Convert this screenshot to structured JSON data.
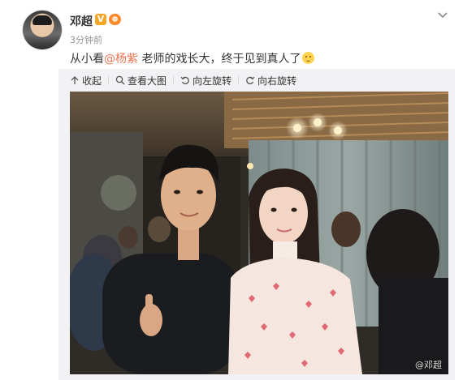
{
  "header": {
    "username": "邓超",
    "verified_badge": "V",
    "timestamp": "3分钟前"
  },
  "post": {
    "text_before": "从小看",
    "mention": "@杨紫",
    "text_after": " 老师的戏长大，终于见到真人了"
  },
  "toolbar": {
    "collapse_label": "收起",
    "view_large_label": "查看大图",
    "rotate_left_label": "向左旋转",
    "rotate_right_label": "向右旋转"
  },
  "photo": {
    "watermark": "@邓超"
  },
  "colors": {
    "mention": "#eb7350",
    "muted": "#939393",
    "badge": "#f5a623"
  }
}
